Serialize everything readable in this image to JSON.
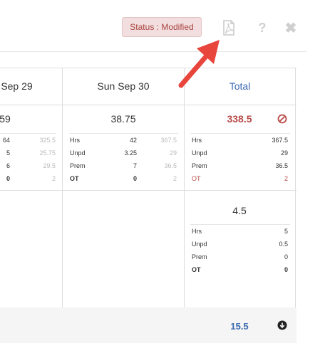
{
  "header": {
    "status_label": "Status : Modified"
  },
  "columns": {
    "sat_label": "Sep 29",
    "sun_label": "Sun Sep 30",
    "total_label": "Total"
  },
  "section1": {
    "sat": {
      "total": "59",
      "rows": [
        {
          "label": "",
          "v1": "64",
          "v2": "325.5"
        },
        {
          "label": "",
          "v1": "5",
          "v2": "25.75"
        },
        {
          "label": "",
          "v1": "6",
          "v2": "29.5"
        },
        {
          "label": "",
          "v1": "0",
          "v2": "2"
        }
      ]
    },
    "sun": {
      "total": "38.75",
      "rows": [
        {
          "label": "Hrs",
          "v1": "42",
          "v2": "367.5"
        },
        {
          "label": "Unpd",
          "v1": "3.25",
          "v2": "29"
        },
        {
          "label": "Prem",
          "v1": "7",
          "v2": "36.5"
        },
        {
          "label": "OT",
          "v1": "0",
          "v2": "2"
        }
      ]
    },
    "total": {
      "total": "338.5",
      "rows": [
        {
          "label": "Hrs",
          "v1": "367.5"
        },
        {
          "label": "Unpd",
          "v1": "29"
        },
        {
          "label": "Prem",
          "v1": "36.5"
        },
        {
          "label": "OT",
          "v1": "2"
        }
      ]
    }
  },
  "section2": {
    "total": {
      "total": "4.5",
      "rows": [
        {
          "label": "Hrs",
          "v1": "5"
        },
        {
          "label": "Unpd",
          "v1": "0.5"
        },
        {
          "label": "Prem",
          "v1": "0"
        },
        {
          "label": "OT",
          "v1": "0"
        }
      ]
    }
  },
  "footer": {
    "total": "15.5"
  },
  "colors": {
    "accent_blue": "#3a68b0",
    "alert_red": "#b94a48",
    "arrow_red": "#e8453c"
  },
  "icons": [
    "pdf-icon",
    "help-icon",
    "close-icon",
    "ban-icon",
    "circle-arrow-down-icon"
  ]
}
